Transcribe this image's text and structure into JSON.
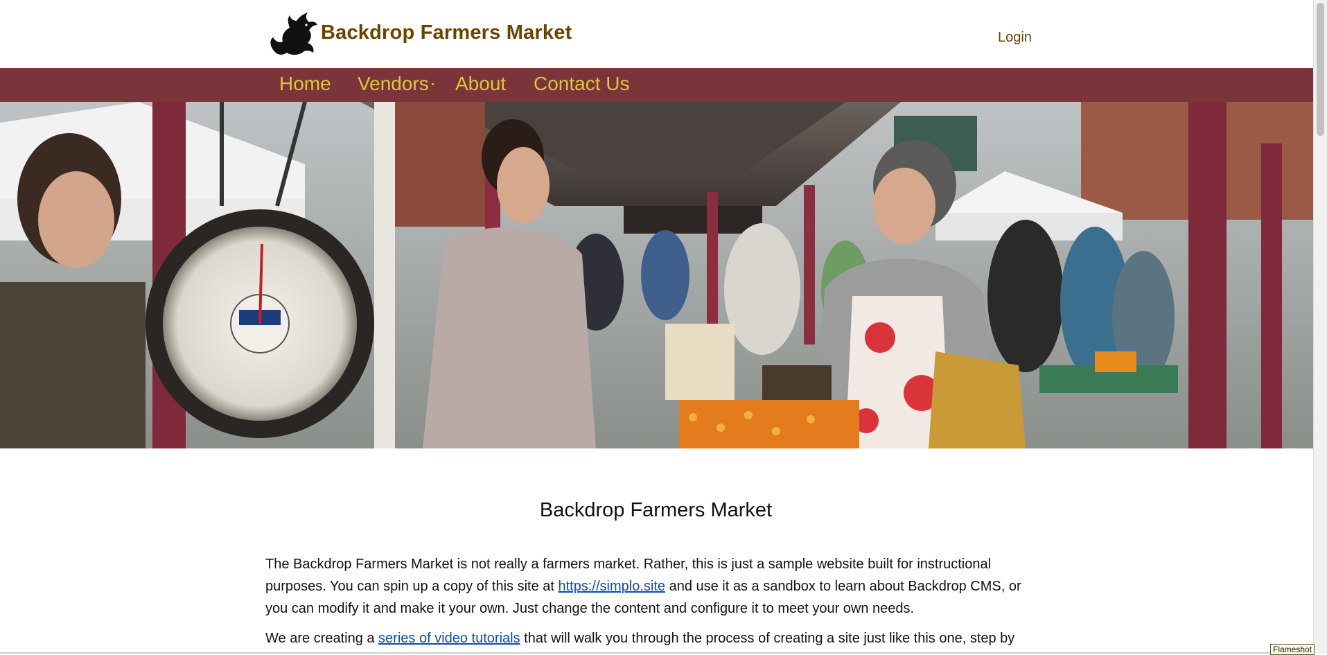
{
  "header": {
    "site_name": "Backdrop Farmers Market",
    "login_label": "Login",
    "logo_icon": "dragon-logo-icon"
  },
  "nav": {
    "items": [
      {
        "label": "Home"
      },
      {
        "label": "Vendors"
      },
      {
        "label": "About"
      },
      {
        "label": "Contact Us"
      }
    ]
  },
  "hero": {
    "icon": "farmers-market-hero-image"
  },
  "main": {
    "title": "Backdrop Farmers Market",
    "para1_a": "The Backdrop Farmers Market is not really a farmers market. Rather, this is just a sample website built for instructional purposes. You can spin up a copy of this site at ",
    "para1_link": "https://simplo.site",
    "para1_b": " and use it as a sandbox to learn about Backdrop CMS, or you can modify it and make it your own. Just change the content and configure it to meet your own needs.",
    "para2_a": "We are creating a ",
    "para2_link": "series of video tutorials",
    "para2_b": " that will walk you through the process of creating a site just like this one, step by"
  },
  "overlay": {
    "flameshot_label": "Flameshot"
  },
  "colors": {
    "brand_brown": "#6b4300",
    "nav_bg": "#7b343a",
    "nav_text": "#dcc73e",
    "link": "#0a4fae"
  }
}
